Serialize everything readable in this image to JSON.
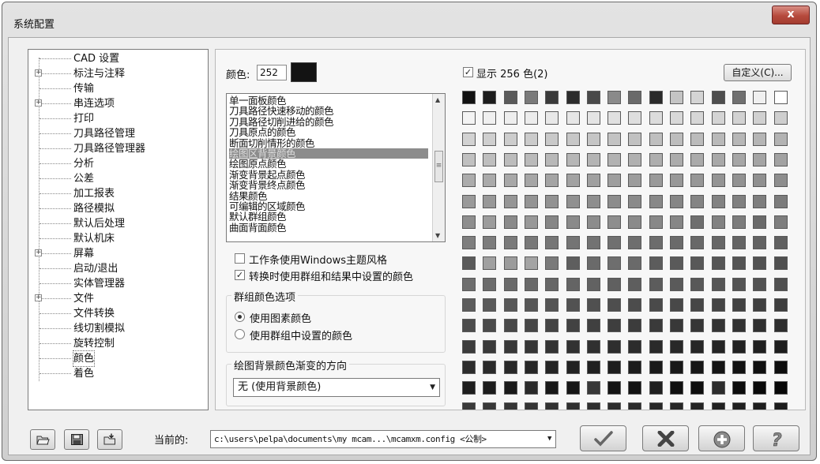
{
  "window": {
    "title": "系统配置",
    "close_label": "x"
  },
  "tree": {
    "items": [
      {
        "label": "CAD 设置",
        "expandable": false,
        "selected": false
      },
      {
        "label": "标注与注释",
        "expandable": true,
        "selected": false
      },
      {
        "label": "传输",
        "expandable": false,
        "selected": false
      },
      {
        "label": "串连选项",
        "expandable": true,
        "selected": false
      },
      {
        "label": "打印",
        "expandable": false,
        "selected": false
      },
      {
        "label": "刀具路径管理",
        "expandable": false,
        "selected": false
      },
      {
        "label": "刀具路径管理器",
        "expandable": false,
        "selected": false
      },
      {
        "label": "分析",
        "expandable": false,
        "selected": false
      },
      {
        "label": "公差",
        "expandable": false,
        "selected": false
      },
      {
        "label": "加工报表",
        "expandable": false,
        "selected": false
      },
      {
        "label": "路径模拟",
        "expandable": false,
        "selected": false
      },
      {
        "label": "默认后处理",
        "expandable": false,
        "selected": false
      },
      {
        "label": "默认机床",
        "expandable": false,
        "selected": false
      },
      {
        "label": "屏幕",
        "expandable": true,
        "selected": false
      },
      {
        "label": "启动/退出",
        "expandable": false,
        "selected": false
      },
      {
        "label": "实体管理器",
        "expandable": false,
        "selected": false
      },
      {
        "label": "文件",
        "expandable": true,
        "selected": false
      },
      {
        "label": "文件转换",
        "expandable": false,
        "selected": false
      },
      {
        "label": "线切割模拟",
        "expandable": false,
        "selected": false
      },
      {
        "label": "旋转控制",
        "expandable": false,
        "selected": false
      },
      {
        "label": "颜色",
        "expandable": false,
        "selected": true
      },
      {
        "label": "着色",
        "expandable": false,
        "selected": false
      }
    ]
  },
  "color": {
    "label": "颜色:",
    "value": "252",
    "swatch_color": "#131313"
  },
  "color_list": {
    "items": [
      {
        "label": "单一面板颜色",
        "selected": false
      },
      {
        "label": "刀具路径快速移动的颜色",
        "selected": false
      },
      {
        "label": "刀具路径切削进给的颜色",
        "selected": false
      },
      {
        "label": "刀具原点的颜色",
        "selected": false
      },
      {
        "label": "断面切削情形的颜色",
        "selected": false
      },
      {
        "label": "绘图区背景颜色",
        "selected": true
      },
      {
        "label": "绘图原点颜色",
        "selected": false
      },
      {
        "label": "渐变背景起点颜色",
        "selected": false
      },
      {
        "label": "渐变背景终点颜色",
        "selected": false
      },
      {
        "label": "结果颜色",
        "selected": false
      },
      {
        "label": "可编辑的区域颜色",
        "selected": false
      },
      {
        "label": "默认群组颜色",
        "selected": false
      },
      {
        "label": "曲面背面颜色",
        "selected": false
      }
    ]
  },
  "options": {
    "windows_theme": {
      "label": "工作条使用Windows主题风格",
      "checked": false
    },
    "use_group_colors": {
      "label": "转换时使用群组和结果中设置的颜色",
      "checked": true
    }
  },
  "group_color": {
    "title": "群组颜色选项",
    "radio_entity": {
      "label": "使用图素颜色",
      "checked": true
    },
    "radio_group": {
      "label": "使用群组中设置的颜色",
      "checked": false
    }
  },
  "gradient": {
    "title": "绘图背景颜色渐变的方向",
    "value": "无 (使用背景颜色)"
  },
  "palette": {
    "show_label": "显示 256 色(2)",
    "show_checked": true,
    "custom_button": "自定义(C)...",
    "rows": [
      [
        "#111111",
        "#1c1c1c",
        "#5a5a5a",
        "#7a7a7a",
        "#3a3a3a",
        "#2c2c2c",
        "#4a4a4a",
        "#8a8a8a",
        "#6a6a6a",
        "#2a2a2a",
        "#c4c4c4",
        "#d4d4d4",
        "#4e4e4e",
        "#707070",
        "#f0f0f0",
        "#ffffff"
      ],
      [
        "#f4f4f4",
        "#f0f0f0",
        "#eeeeee",
        "#ececec",
        "#e8e8e8",
        "#e6e6e6",
        "#e4e4e4",
        "#e0e0e0",
        "#dedede",
        "#dcdcdc",
        "#d8d8d8",
        "#d6d6d6",
        "#d4d4d4",
        "#d2d2d2",
        "#d0d0d0",
        "#cecece"
      ],
      [
        "#d2d2d2",
        "#cfcfcf",
        "#cdcdcd",
        "#cbcbcb",
        "#c9c9c9",
        "#c7c7c7",
        "#c5c5c5",
        "#c3c3c3",
        "#c1c1c1",
        "#bfbfbf",
        "#bdbdbd",
        "#bbbbbb",
        "#b9b9b9",
        "#b7b7b7",
        "#b5b5b5",
        "#b3b3b3"
      ],
      [
        "#c0c0c0",
        "#bebebe",
        "#bcbcbc",
        "#bababa",
        "#b8b8b8",
        "#b6b6b6",
        "#b4b4b4",
        "#b2b2b2",
        "#b0b0b0",
        "#aeaeae",
        "#acacac",
        "#aaaaaa",
        "#a8a8a8",
        "#a6a6a6",
        "#a4a4a4",
        "#a2a2a2"
      ],
      [
        "#acacac",
        "#aaaaaa",
        "#a8a8a8",
        "#a6a6a6",
        "#a4a4a4",
        "#a2a2a2",
        "#a0a0a0",
        "#9e9e9e",
        "#9c9c9c",
        "#9a9a9a",
        "#989898",
        "#969696",
        "#949494",
        "#929292",
        "#909090",
        "#8e8e8e"
      ],
      [
        "#9a9a9a",
        "#989898",
        "#969696",
        "#949494",
        "#929292",
        "#909090",
        "#8e8e8e",
        "#8c8c8c",
        "#8a8a8a",
        "#888888",
        "#868686",
        "#848484",
        "#828282",
        "#808080",
        "#7e7e7e",
        "#7c7c7c"
      ],
      [
        "#8e8e8e",
        "#9c9c9c",
        "#8a8a8a",
        "#989898",
        "#868686",
        "#8a8a8a",
        "#8c8c8c",
        "#8e8e8e",
        "#8a8a8a",
        "#888888",
        "#868686",
        "#6e6e6e",
        "#828282",
        "#7c7c7c",
        "#6a6a6a",
        "#7e7e7e"
      ],
      [
        "#7e7e7e",
        "#7c7c7c",
        "#7a7a7a",
        "#787878",
        "#767676",
        "#747474",
        "#727272",
        "#707070",
        "#6e6e6e",
        "#6c6c6c",
        "#6a6a6a",
        "#686868",
        "#666666",
        "#646464",
        "#626262",
        "#606060"
      ],
      [
        "#5a5a5a",
        "#a0a0a0",
        "#9c9c9c",
        "#a4a4a4",
        "#7a7a7a",
        "#5e5e5e",
        "#6a6a6a",
        "#6e6e6e",
        "#6a6a6a",
        "#5c5c5c",
        "#5a5a5a",
        "#585858",
        "#565656",
        "#545454",
        "#525252",
        "#505050"
      ],
      [
        "#6e6e6e",
        "#6c6c6c",
        "#6a6a6a",
        "#686868",
        "#666666",
        "#646464",
        "#626262",
        "#606060",
        "#5e5e5e",
        "#5c5c5c",
        "#5a5a5a",
        "#585858",
        "#565656",
        "#545454",
        "#525252",
        "#505050"
      ],
      [
        "#5c5c5c",
        "#5a5a5a",
        "#585858",
        "#565656",
        "#545454",
        "#525252",
        "#505050",
        "#4e4e4e",
        "#4c4c4c",
        "#4a4a4a",
        "#484848",
        "#464646",
        "#444444",
        "#424242",
        "#404040",
        "#3e3e3e"
      ],
      [
        "#4c4c4c",
        "#4a4a4a",
        "#484848",
        "#464646",
        "#444444",
        "#424242",
        "#404040",
        "#3e3e3e",
        "#3c3c3c",
        "#3a3a3a",
        "#383838",
        "#363636",
        "#343434",
        "#323232",
        "#303030",
        "#2e2e2e"
      ],
      [
        "#3c3c3c",
        "#3a3a3a",
        "#383838",
        "#363636",
        "#343434",
        "#323232",
        "#303030",
        "#2e2e2e",
        "#2c2c2c",
        "#2a2a2a",
        "#282828",
        "#262626",
        "#242424",
        "#222222",
        "#202020",
        "#1e1e1e"
      ],
      [
        "#2c2c2c",
        "#2a2a2a",
        "#282828",
        "#262626",
        "#242424",
        "#222222",
        "#202020",
        "#1e1e1e",
        "#1c1c1c",
        "#1a1a1a",
        "#181818",
        "#161616",
        "#141414",
        "#121212",
        "#101010",
        "#0e0e0e"
      ],
      [
        "#1e1e1e",
        "#1c1c1c",
        "#1a1a1a",
        "#2a2a2a",
        "#181818",
        "#161616",
        "#383838",
        "#141414",
        "#121212",
        "#202020",
        "#101010",
        "#0e0e0e",
        "#2c2c2c",
        "#0c0c0c",
        "#0a0a0a",
        "#080808"
      ],
      [
        "#3a3a3a",
        "#383838",
        "#363636",
        "#343434",
        "#323232",
        "#303030",
        "#2e2e2e",
        "#2c2c2c",
        "#2a2a2a",
        "#282828",
        "#262626",
        "#242424",
        "#222222",
        "#202020",
        "#1e1e1e",
        "#1c1c1c"
      ],
      [
        "#262626",
        "#242424",
        "#222222",
        "#202020",
        "#1e1e1e",
        "#1c1c1c",
        "#1a1a1a",
        "#181818",
        "#161616",
        "#141414",
        "#121212",
        "#101010",
        "#0e0e0e",
        "#0c0c0c",
        "#0a0a0a",
        "#080808"
      ]
    ]
  },
  "footer": {
    "current_label": "当前的:",
    "config_path": "c:\\users\\pelpa\\documents\\my mcam...\\mcamxm.config <公制>",
    "buttons": {
      "open_icon": "open-folder-icon",
      "save_icon": "save-disk-icon",
      "merge_icon": "merge-folder-icon",
      "ok_icon": "checkmark-icon",
      "cancel_icon": "x-mark-icon",
      "apply_icon": "plus-circle-icon",
      "help_icon": "question-icon"
    }
  }
}
